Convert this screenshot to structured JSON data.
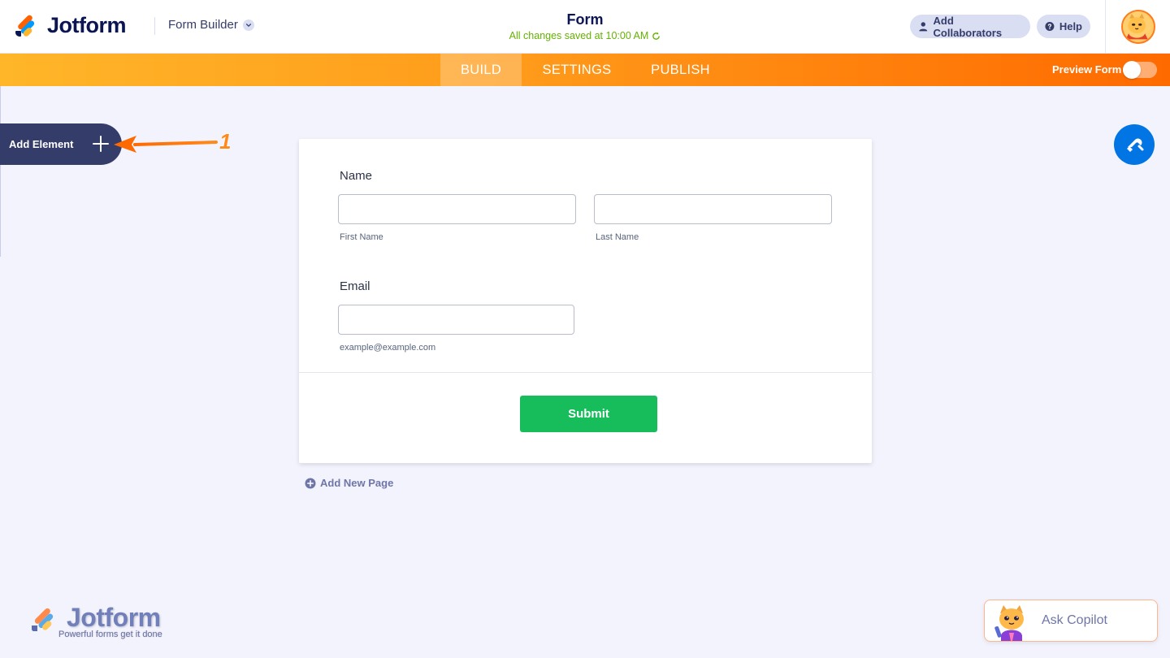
{
  "header": {
    "brand": "Jotform",
    "builder_label": "Form Builder",
    "form_title": "Form",
    "saved_status": "All changes saved at 10:00 AM",
    "collaborators_label": "Add Collaborators",
    "help_label": "Help"
  },
  "nav": {
    "tabs": [
      {
        "label": "BUILD",
        "active": true
      },
      {
        "label": "SETTINGS",
        "active": false
      },
      {
        "label": "PUBLISH",
        "active": false
      }
    ],
    "preview_label": "Preview Form",
    "preview_enabled": false
  },
  "sidebar": {
    "add_element_label": "Add Element",
    "annotation_number": "1"
  },
  "form": {
    "name_label": "Name",
    "first_name_value": "",
    "first_name_sublabel": "First Name",
    "last_name_value": "",
    "last_name_sublabel": "Last Name",
    "email_label": "Email",
    "email_value": "",
    "email_sublabel": "example@example.com",
    "submit_label": "Submit"
  },
  "add_page_label": "Add New Page",
  "watermark": {
    "brand": "Jotform",
    "tagline": "Powerful forms get it done"
  },
  "copilot": {
    "label": "Ask Copilot"
  },
  "colors": {
    "accent_orange": "#ff6100",
    "nav_gradient_start": "#ffb629",
    "nav_gradient_end": "#ff6a00",
    "submit_green": "#18bd5b",
    "designer_blue": "#0075e3",
    "saved_green": "#64b200",
    "navy": "#0a1551"
  },
  "icons": {
    "logo": "jotform-logo-icon",
    "builder_dropdown": "chevron-down-icon",
    "saved_status": "refresh-icon",
    "collaborators": "user-icon",
    "help": "question-icon",
    "add_element": "plus-icon",
    "designer": "paint-roller-icon",
    "add_page": "plus-circle-icon",
    "copilot": "cat-avatar-icon"
  }
}
